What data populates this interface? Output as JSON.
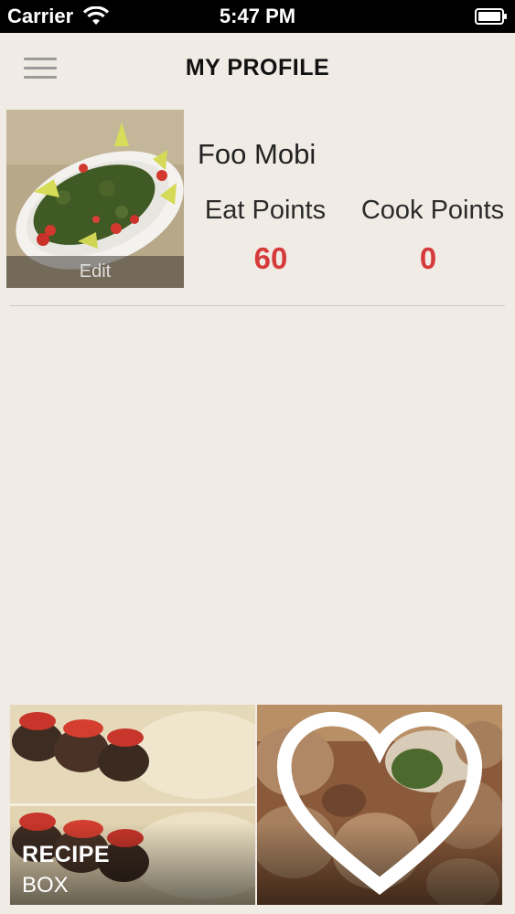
{
  "status": {
    "carrier": "Carrier",
    "time": "5:47 PM"
  },
  "header": {
    "title": "MY PROFILE"
  },
  "profile": {
    "name": "Foo Mobi",
    "avatar_edit_label": "Edit",
    "eat_points_label": "Eat Points",
    "eat_points_value": "60",
    "cook_points_label": "Cook Points",
    "cook_points_value": "0"
  },
  "tiles": {
    "recipe_box_title": "RECIPE",
    "recipe_box_subtitle": "BOX"
  },
  "colors": {
    "background": "#f1ebe5",
    "accent": "#d63b3b"
  },
  "icons": {
    "menu": "hamburger-menu-icon",
    "favorite": "heart-outline-icon",
    "wifi": "wifi-icon",
    "battery": "battery-icon"
  }
}
